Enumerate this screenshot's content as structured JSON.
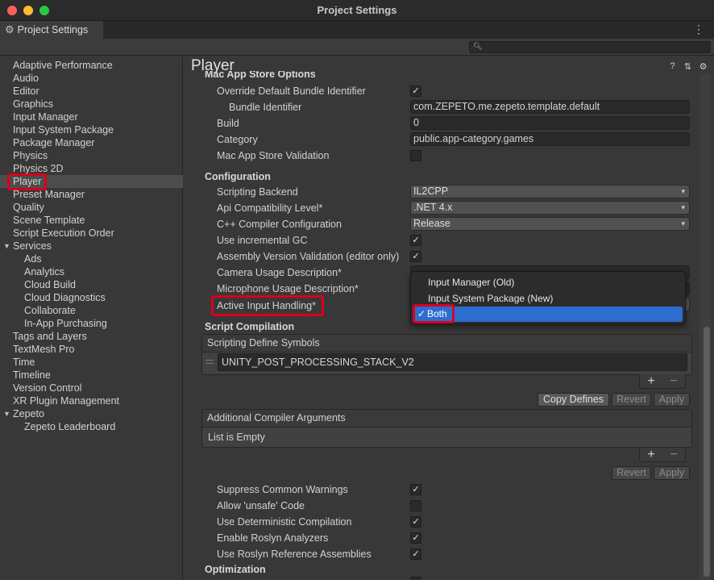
{
  "window": {
    "title": "Project Settings"
  },
  "tab": {
    "label": "Project Settings"
  },
  "sidebar": {
    "items": [
      "Adaptive Performance",
      "Audio",
      "Editor",
      "Graphics",
      "Input Manager",
      "Input System Package",
      "Package Manager",
      "Physics",
      "Physics 2D",
      "Player",
      "Preset Manager",
      "Quality",
      "Scene Template",
      "Script Execution Order",
      "Services",
      "Ads",
      "Analytics",
      "Cloud Build",
      "Cloud Diagnostics",
      "Collaborate",
      "In-App Purchasing",
      "Tags and Layers",
      "TextMesh Pro",
      "Time",
      "Timeline",
      "Version Control",
      "XR Plugin Management",
      "Zepeto",
      "Zepeto Leaderboard"
    ],
    "selected": "Player"
  },
  "main": {
    "title": "Player",
    "mac_store": {
      "section": "Mac App Store Options",
      "override_label": "Override Default Bundle Identifier",
      "override_checked": true,
      "bundle_id_label": "Bundle Identifier",
      "bundle_id_value": "com.ZEPETO.me.zepeto.template.default",
      "build_label": "Build",
      "build_value": "0",
      "category_label": "Category",
      "category_value": "public.app-category.games",
      "validation_label": "Mac App Store Validation",
      "validation_checked": false
    },
    "configuration": {
      "section": "Configuration",
      "scripting_backend_label": "Scripting Backend",
      "scripting_backend_value": "IL2CPP",
      "api_level_label": "Api Compatibility Level*",
      "api_level_value": ".NET 4.x",
      "cpp_config_label": "C++ Compiler Configuration",
      "cpp_config_value": "Release",
      "incremental_gc_label": "Use incremental GC",
      "assembly_validation_label": "Assembly Version Validation (editor only)",
      "camera_desc_label": "Camera Usage Description*",
      "mic_desc_label": "Microphone Usage Description*",
      "active_input_label": "Active Input Handling*"
    },
    "active_input_popup": {
      "options": [
        "Input Manager (Old)",
        "Input System Package (New)",
        "Both"
      ],
      "selected": "Both",
      "check": "✓"
    },
    "script_compilation": {
      "section": "Script Compilation",
      "define_symbols_header": "Scripting Define Symbols",
      "define_symbol": "UNITY_POST_PROCESSING_STACK_V2",
      "copy_defines": "Copy Defines",
      "revert": "Revert",
      "apply": "Apply",
      "compiler_args_header": "Additional Compiler Arguments",
      "list_empty": "List is Empty",
      "plus": "+",
      "minus": "−"
    },
    "warnings": {
      "suppress_label": "Suppress Common Warnings",
      "unsafe_label": "Allow 'unsafe' Code",
      "deterministic_label": "Use Deterministic Compilation",
      "roslyn_analyzers_label": "Enable Roslyn Analyzers",
      "roslyn_refs_label": "Use Roslyn Reference Assemblies"
    },
    "optimization": {
      "section": "Optimization"
    }
  },
  "icons": {
    "gear": "⚙",
    "kebab": "⋮",
    "search": "🔍",
    "help": "?",
    "presets": "⇅",
    "settings": "⚙",
    "caret": "▾",
    "fold_open": "▼",
    "check": "✓"
  },
  "colors": {
    "highlight": "#d8001c",
    "selection": "#2e6dd0"
  }
}
